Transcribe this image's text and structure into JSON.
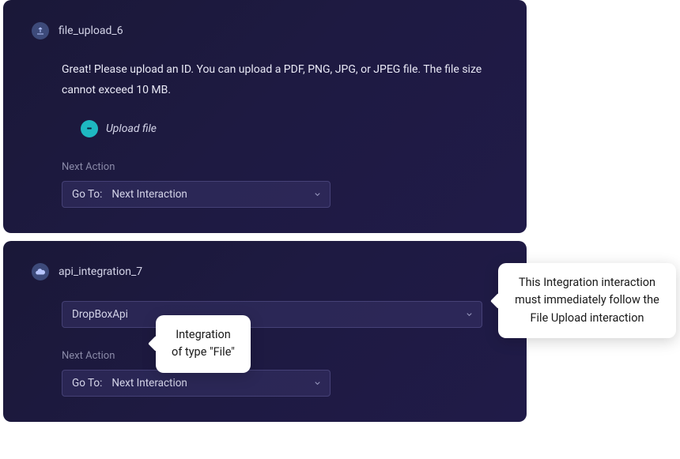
{
  "card1": {
    "title": "file_upload_6",
    "body": "Great! Please upload an ID. You can upload a PDF, PNG, JPG, or JPEG file. The file size cannot exceed 10 MB.",
    "upload_label": "Upload file",
    "next_action_label": "Next Action",
    "goto_prefix": "Go To:",
    "goto_value": "Next Interaction"
  },
  "card2": {
    "title": "api_integration_7",
    "integration_value": "DropBoxApi",
    "next_action_label": "Next Action",
    "goto_prefix": "Go To:",
    "goto_value": "Next Interaction"
  },
  "tooltips": {
    "integration_type": "Integration of type \"File\"",
    "follow_note": "This Integration interaction must immediately follow the File Upload interaction"
  }
}
